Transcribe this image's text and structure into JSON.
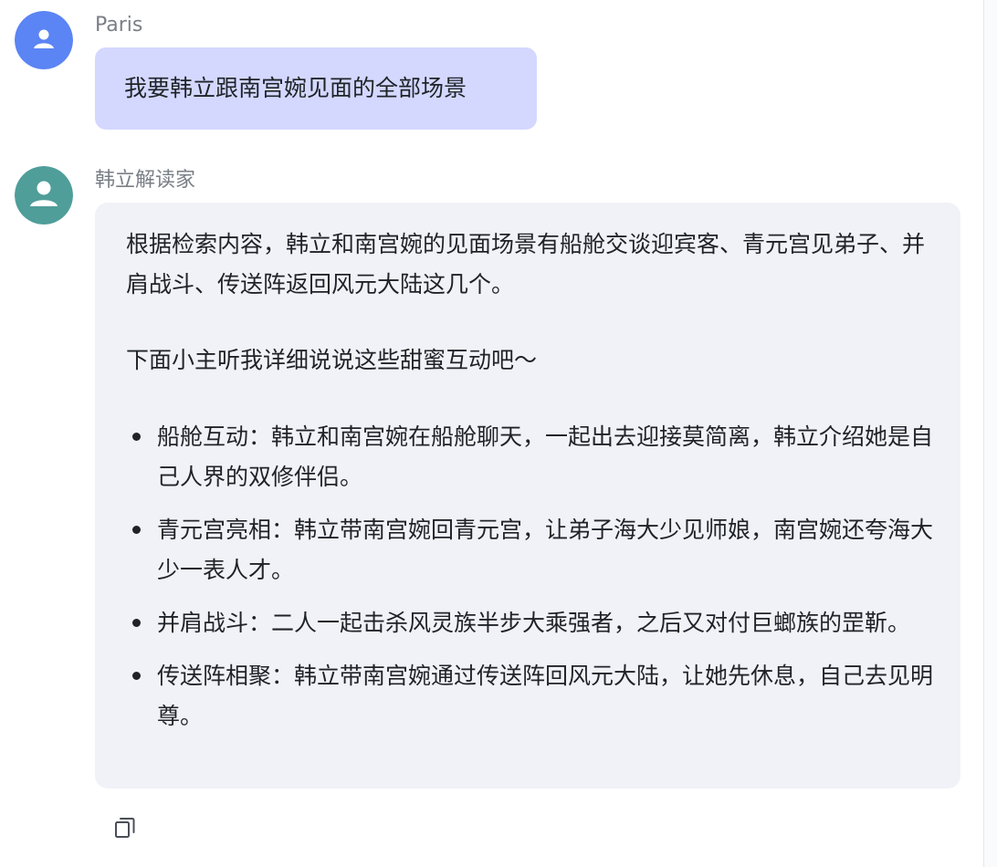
{
  "user_message": {
    "sender": "Paris",
    "text": "我要韩立跟南宫婉见面的全部场景",
    "avatar_icon": "person-icon",
    "avatar_color": "#5b84f4"
  },
  "assistant_message": {
    "sender": "韩立解读家",
    "avatar_icon": "person-icon",
    "avatar_color": "#4f9e9a",
    "intro": "根据检索内容，韩立和南宫婉的见面场景有船舱交谈迎宾客、青元宫见弟子、并肩战斗、传送阵返回风元大陆这几个。",
    "lead": "下面小主听我详细说说这些甜蜜互动吧～",
    "bullets": [
      "船舱互动：韩立和南宫婉在船舱聊天，一起出去迎接莫简离，韩立介绍她是自己人界的双修伴侣。",
      "青元宫亮相：韩立带南宫婉回青元宫，让弟子海大少见师娘，南宫婉还夸海大少一表人才。",
      "并肩战斗：二人一起击杀风灵族半步大乘强者，之后又对付巨螂族的罡靳。",
      "传送阵相聚：韩立带南宫婉通过传送阵回风元大陆，让她先休息，自己去见明尊。"
    ]
  },
  "actions": {
    "copy_icon": "copy-icon"
  },
  "colors": {
    "user_bubble": "#d4d8ff",
    "assistant_bubble": "#f1f2f7",
    "sender_text": "#7a7f87"
  }
}
